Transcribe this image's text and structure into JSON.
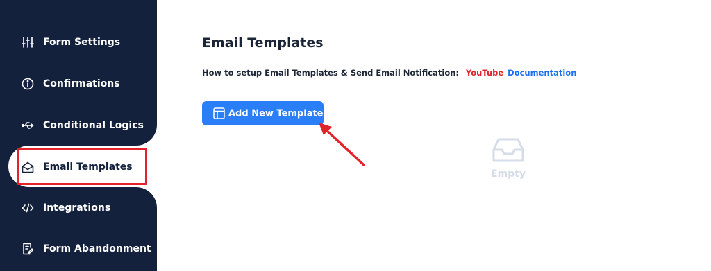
{
  "sidebar": {
    "items": [
      {
        "label": "Form Settings",
        "icon": "sliders-icon",
        "active": false
      },
      {
        "label": "Confirmations",
        "icon": "info-circle-icon",
        "active": false
      },
      {
        "label": "Conditional Logics",
        "icon": "usb-icon",
        "active": false
      },
      {
        "label": "Email Templates",
        "icon": "envelope-open-icon",
        "active": true
      },
      {
        "label": "Integrations",
        "icon": "code-icon",
        "active": false
      },
      {
        "label": "Form Abandonment",
        "icon": "clipboard-edit-icon",
        "active": false
      }
    ]
  },
  "main": {
    "title": "Email Templates",
    "help": {
      "text": "How to setup Email Templates & Send Email Notification:",
      "youtube_label": "YouTube",
      "documentation_label": "Documentation"
    },
    "add_button_label": "Add New Template",
    "empty_label": "Empty"
  },
  "colors": {
    "sidebar_bg": "#14213d",
    "accent": "#2a7ef8",
    "annotation_red": "#e3222c",
    "link_blue": "#1a6ff5",
    "empty_gray": "#d6dde8"
  }
}
